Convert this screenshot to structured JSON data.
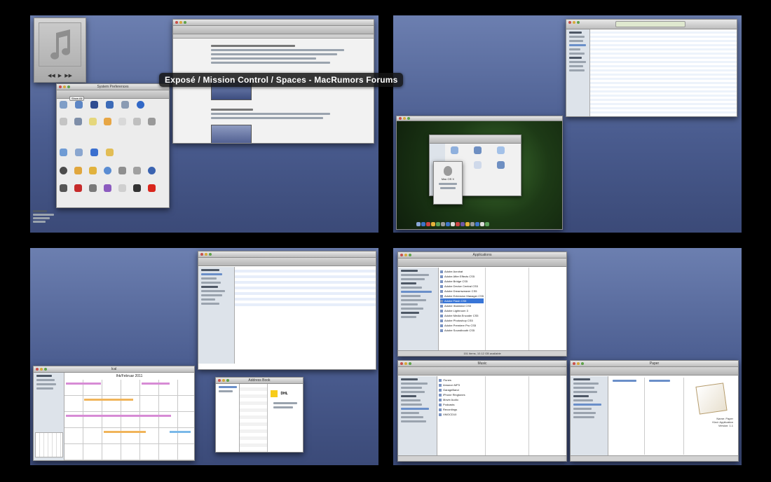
{
  "tooltip": {
    "label": "Exposé / Mission Control / Spaces - MacRumors Forums"
  },
  "spaces": [
    {
      "name": "space-1"
    },
    {
      "name": "space-2"
    },
    {
      "name": "space-3"
    },
    {
      "name": "space-4"
    }
  ],
  "windows": {
    "sysprefs": {
      "title": "System Preferences",
      "show_all": "Show All"
    },
    "finder_apps": {
      "title": "Applications",
      "status": "151 items, 10.12 GB available"
    },
    "finder_music": {
      "title": "Music"
    },
    "finder_paper": {
      "title": "Paper"
    },
    "about_mac": {
      "title": "Mac OS X"
    },
    "calendar": {
      "title": "Ical",
      "month": "Ihk/Februar 2011"
    },
    "address_book": {
      "title": "Address Book",
      "contact": "DHL"
    }
  },
  "apps_list": [
    "Adobe Acrobat",
    "Adobe After Effects CS5",
    "Adobe Bridge CS5",
    "Adobe Device Central CS5",
    "Adobe Dreamweaver CS5",
    "Adobe Extension Manager CS5",
    "Adobe Flash CS5",
    "Adobe Illustrator CS5",
    "Adobe Lightroom 3",
    "Adobe Media Encoder CS5",
    "Adobe Photoshop CS5",
    "Adobe Premiere Pro CS5",
    "Adobe Soundbooth CS5"
  ],
  "music_list": [
    "iTunes",
    "Amazon MP3",
    "GarageBand",
    "iPhone Ringtones",
    "Movie Audio",
    "Podcasts",
    "Recordings",
    "VMOCD10"
  ],
  "paper_info": [
    "Name: Paper",
    "Kind: Application",
    "Version: 1.1"
  ],
  "colors": {
    "space_top": "#6c7fb0",
    "space_bottom": "#3b4a78",
    "tooltip_bg": "#141414",
    "selection": "#6a8fc9"
  }
}
